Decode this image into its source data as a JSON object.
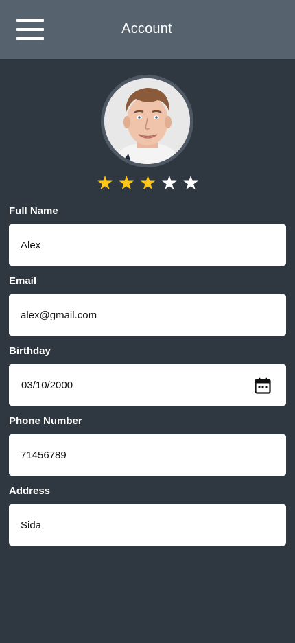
{
  "header": {
    "title": "Account",
    "menu_icon": "hamburger-menu-icon"
  },
  "profile": {
    "avatar_icon": "user-photo",
    "rating": 3,
    "rating_max": 5,
    "star_on_color": "#ffc617",
    "star_off_color": "#ffffff"
  },
  "form": {
    "full_name": {
      "label": "Full Name",
      "value": "Alex"
    },
    "email": {
      "label": "Email",
      "value": "alex@gmail.com"
    },
    "birthday": {
      "label": "Birthday",
      "value": "03/10/2000",
      "icon": "calendar-icon"
    },
    "phone": {
      "label": "Phone Number",
      "value": "71456789"
    },
    "address": {
      "label": "Address",
      "value": "Sida"
    }
  },
  "colors": {
    "background": "#2f3740",
    "appbar": "#56626d"
  }
}
